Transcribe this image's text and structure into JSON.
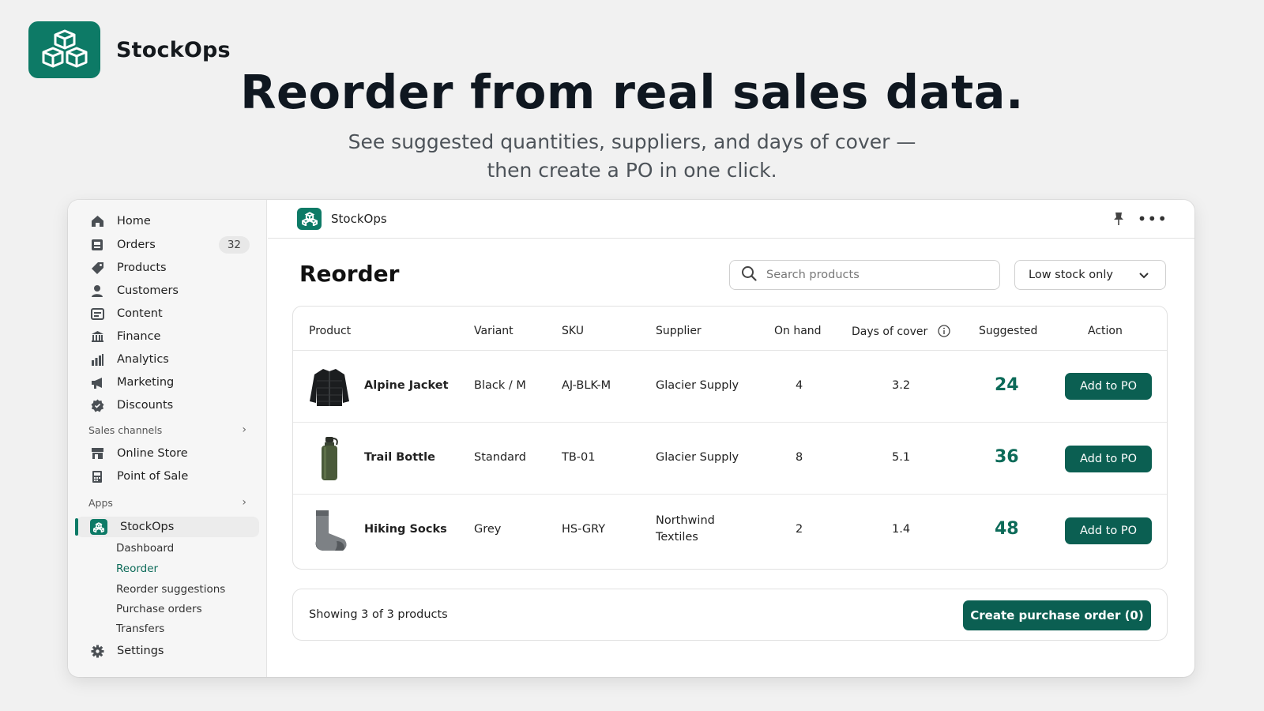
{
  "brand": {
    "name": "StockOps"
  },
  "hero": {
    "title": "Reorder from real sales data.",
    "subtitle_line1": "See suggested quantities, suppliers, and days of cover —",
    "subtitle_line2": "then create a PO in one click."
  },
  "colors": {
    "accent": "#0d7a66",
    "button": "#0b5f52",
    "suggested": "#0d6b59"
  },
  "sidebar": {
    "items": [
      {
        "label": "Home",
        "icon": "home-icon"
      },
      {
        "label": "Orders",
        "icon": "orders-icon",
        "badge": "32"
      },
      {
        "label": "Products",
        "icon": "tag-icon"
      },
      {
        "label": "Customers",
        "icon": "person-icon"
      },
      {
        "label": "Content",
        "icon": "content-icon"
      },
      {
        "label": "Finance",
        "icon": "bank-icon"
      },
      {
        "label": "Analytics",
        "icon": "bar-chart-icon"
      },
      {
        "label": "Marketing",
        "icon": "megaphone-icon"
      },
      {
        "label": "Discounts",
        "icon": "discount-icon"
      }
    ],
    "sales_channels_label": "Sales channels",
    "channels": [
      {
        "label": "Online Store",
        "icon": "store-icon"
      },
      {
        "label": "Point of Sale",
        "icon": "pos-icon"
      }
    ],
    "apps_label": "Apps",
    "app": {
      "label": "StockOps",
      "icon": "stockops-icon"
    },
    "app_subitems": [
      "Dashboard",
      "Reorder",
      "Reorder suggestions",
      "Purchase orders",
      "Transfers"
    ],
    "current_subitem": "Reorder",
    "settings_label": "Settings"
  },
  "topbar": {
    "app_name": "StockOps"
  },
  "page": {
    "title": "Reorder",
    "search_placeholder": "Search products",
    "filter_value": "Low stock only"
  },
  "table": {
    "headers": {
      "product": "Product",
      "variant": "Variant",
      "sku": "SKU",
      "supplier": "Supplier",
      "on_hand": "On hand",
      "days_of_cover": "Days of cover",
      "suggested": "Suggested",
      "action": "Action"
    },
    "rows": [
      {
        "product": "Alpine Jacket",
        "image": "jacket-image",
        "variant": "Black / M",
        "sku": "AJ-BLK-M",
        "supplier_line1": "Glacier Supply",
        "supplier_line2": "",
        "on_hand": "4",
        "days_of_cover": "3.2",
        "suggested": "24",
        "action": "Add to PO"
      },
      {
        "product": "Trail Bottle",
        "image": "bottle-image",
        "variant": "Standard",
        "sku": "TB-01",
        "supplier_line1": "Glacier Supply",
        "supplier_line2": "",
        "on_hand": "8",
        "days_of_cover": "5.1",
        "suggested": "36",
        "action": "Add to PO"
      },
      {
        "product": "Hiking Socks",
        "image": "sock-image",
        "variant": "Grey",
        "sku": "HS-GRY",
        "supplier_line1": "Northwind",
        "supplier_line2": "Textiles",
        "on_hand": "2",
        "days_of_cover": "1.4",
        "suggested": "48",
        "action": "Add to PO"
      }
    ]
  },
  "footer": {
    "showing": "Showing 3 of 3 products",
    "create_button": "Create purchase order (0)"
  }
}
